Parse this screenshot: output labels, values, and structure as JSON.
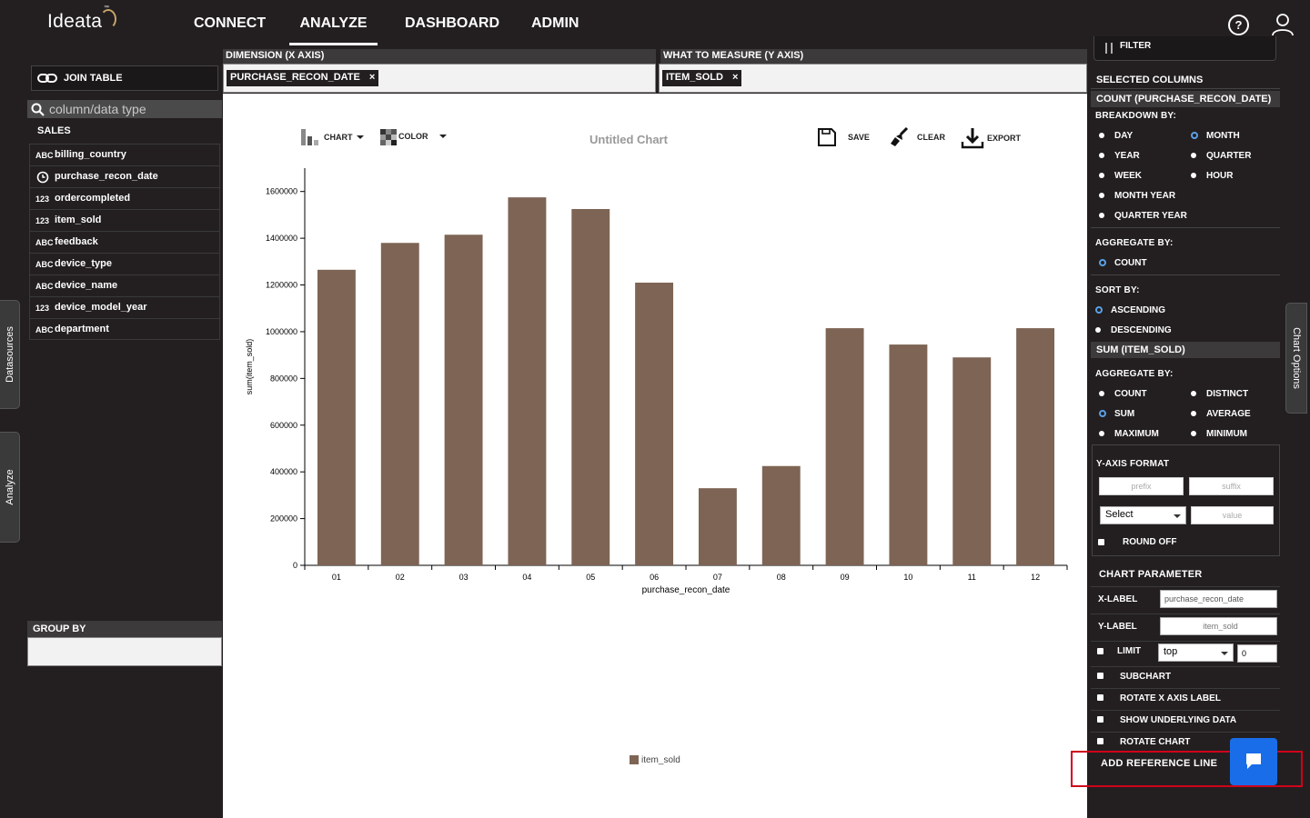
{
  "app": {
    "logo": "Ideata"
  },
  "nav": [
    {
      "label": "CONNECT"
    },
    {
      "label": "ANALYZE"
    },
    {
      "label": "DASHBOARD"
    },
    {
      "label": "ADMIN"
    }
  ],
  "side_tabs": {
    "datasources": "Datasources",
    "analyze": "Analyze",
    "chart_options": "Chart Options"
  },
  "left": {
    "join_table": "JOIN TABLE",
    "search_placeholder": "column/data type",
    "group_label": "SALES",
    "fields": [
      {
        "name": "billing_country",
        "icon": "abc"
      },
      {
        "name": "purchase_recon_date",
        "icon": "clock"
      },
      {
        "name": "ordercompleted",
        "icon": "123"
      },
      {
        "name": "item_sold",
        "icon": "123"
      },
      {
        "name": "feedback",
        "icon": "abc"
      },
      {
        "name": "device_type",
        "icon": "abc"
      },
      {
        "name": "device_name",
        "icon": "abc"
      },
      {
        "name": "device_model_year",
        "icon": "123"
      },
      {
        "name": "department",
        "icon": "abc"
      }
    ],
    "group_by": "GROUP BY"
  },
  "zones": {
    "x_label": "DIMENSION (X AXIS)",
    "x_chip": "PURCHASE_RECON_DATE",
    "y_label": "WHAT TO MEASURE (Y AXIS)",
    "y_chip": "ITEM_SOLD",
    "remove": "×"
  },
  "toolbar": {
    "chart": "CHART",
    "color": "COLOR",
    "title": "Untitled Chart",
    "save": "SAVE",
    "clear": "CLEAR",
    "export": "EXPORT"
  },
  "chart_data": {
    "type": "bar",
    "categories": [
      "01",
      "02",
      "03",
      "04",
      "05",
      "06",
      "07",
      "08",
      "09",
      "10",
      "11",
      "12"
    ],
    "series": [
      {
        "name": "item_sold",
        "color": "#7d6454",
        "values": [
          1265000,
          1380000,
          1415000,
          1575000,
          1525000,
          1210000,
          330000,
          425000,
          1015000,
          945000,
          890000,
          1015000
        ]
      }
    ],
    "xlabel": "purchase_recon_date",
    "ylabel": "sum(item_sold)",
    "ylim": [
      0,
      1700000
    ],
    "yticks": [
      0,
      200000,
      400000,
      600000,
      800000,
      1000000,
      1200000,
      1400000,
      1600000
    ],
    "legend": "bottom",
    "grid": false
  },
  "right": {
    "filter": "FILTER",
    "selected_columns": "SELECTED COLUMNS",
    "count_header": "COUNT (PURCHASE_RECON_DATE)",
    "breakdown_by": "BREAKDOWN BY:",
    "breakdown_options": [
      "DAY",
      "MONTH",
      "YEAR",
      "QUARTER",
      "WEEK",
      "HOUR",
      "MONTH YEAR",
      "QUARTER YEAR"
    ],
    "aggregate_by": "AGGREGATE BY:",
    "count_option": "COUNT",
    "sort_by": "SORT BY:",
    "sort_options": [
      "ASCENDING",
      "DESCENDING"
    ],
    "sum_header": "SUM (ITEM_SOLD)",
    "agg_options": [
      "COUNT",
      "DISTINCT",
      "SUM",
      "AVERAGE",
      "MAXIMUM",
      "MINIMUM"
    ],
    "y_axis_format": "Y-AXIS FORMAT",
    "prefix_ph": "prefix",
    "suffix_ph": "suffix",
    "select_value": "Select",
    "value_ph": "value",
    "round_off": "ROUND OFF",
    "chart_parameter": "CHART PARAMETER",
    "x_label": "X-LABEL",
    "x_label_value": "purchase_recon_date",
    "y_label": "Y-LABEL",
    "y_label_ph": "item_sold",
    "limit": "LIMIT",
    "limit_select": "top",
    "limit_value": "0",
    "subchart": "SUBCHART",
    "rotate_x": "ROTATE X AXIS LABEL",
    "show_data": "SHOW UNDERLYING DATA",
    "rotate_chart": "ROTATE CHART",
    "add_ref_line": "ADD REFERENCE LINE"
  }
}
